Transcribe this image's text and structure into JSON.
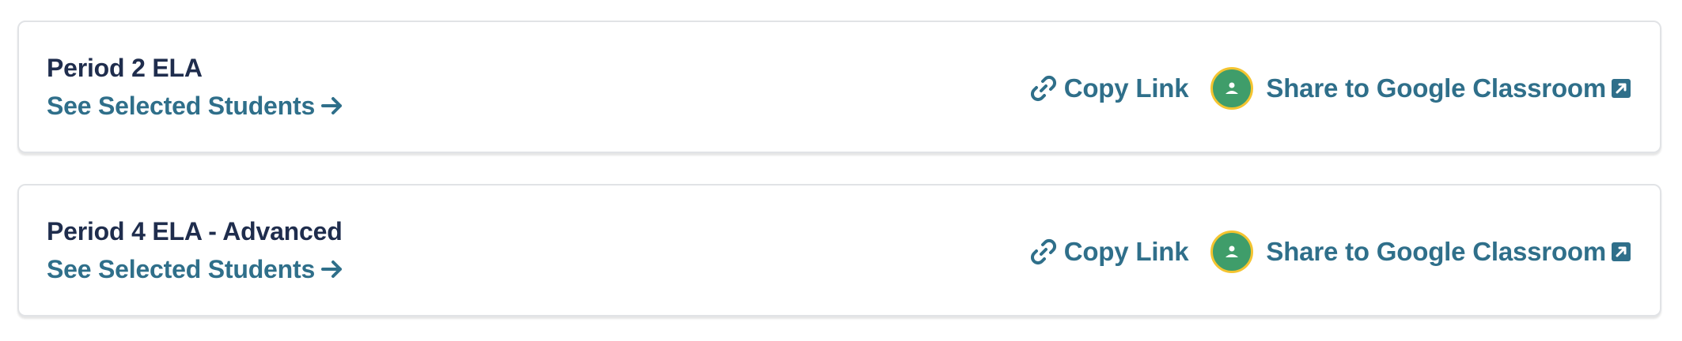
{
  "colors": {
    "title_text": "#1f2d4d",
    "link_text": "#2f6f8a",
    "classroom_green": "#3f9d6a",
    "classroom_ring": "#f4c430",
    "card_border": "#e1e3e6"
  },
  "classes": [
    {
      "name": "Period 2 ELA",
      "see_students_label": "See Selected Students",
      "copy_link_label": "Copy Link",
      "share_label": "Share to Google Classroom",
      "icons": {
        "arrow": "arrow-right-icon",
        "copy": "link-icon",
        "classroom": "google-classroom-icon",
        "external": "external-link-icon"
      }
    },
    {
      "name": "Period 4 ELA - Advanced",
      "see_students_label": "See Selected Students",
      "copy_link_label": "Copy Link",
      "share_label": "Share to Google Classroom",
      "icons": {
        "arrow": "arrow-right-icon",
        "copy": "link-icon",
        "classroom": "google-classroom-icon",
        "external": "external-link-icon"
      }
    }
  ]
}
